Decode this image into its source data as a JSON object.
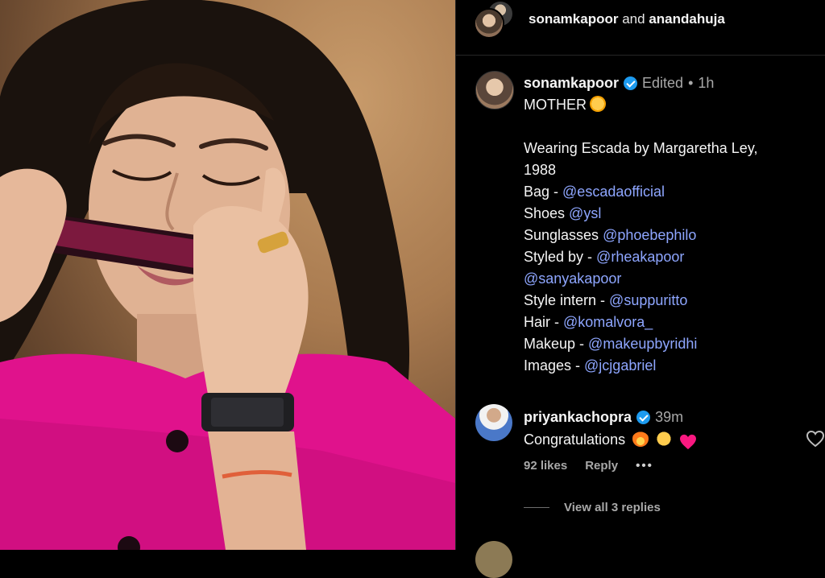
{
  "header": {
    "user1": "sonamkapoor",
    "and": "and",
    "user2": "anandahuja"
  },
  "caption": {
    "username": "sonamkapoor",
    "edited": "Edited",
    "dot": "•",
    "time": "1h",
    "lines": [
      {
        "text": "MOTHER",
        "link": ""
      },
      {
        "text": "",
        "link": ""
      },
      {
        "text": "Wearing Escada by Margaretha Ley,",
        "link": ""
      },
      {
        "text": "1988",
        "link": ""
      },
      {
        "text": "Bag - ",
        "link": "@escadaofficial"
      },
      {
        "text": "Shoes ",
        "link": "@ysl"
      },
      {
        "text": "Sunglasses ",
        "link": "@phoebephilo"
      },
      {
        "text": "Styled by - ",
        "link": "@rheakapoor"
      },
      {
        "text": "",
        "link": "@sanyakapoor"
      },
      {
        "text": "Style intern - ",
        "link": "@suppuritto"
      },
      {
        "text": "Hair - ",
        "link": "@komalvora_"
      },
      {
        "text": "Makeup - ",
        "link": "@makeupbyridhi"
      },
      {
        "text": "Images - ",
        "link": "@jcjgabriel"
      }
    ],
    "emoji": "kissing-face-emoji"
  },
  "comment": {
    "username": "priyankachopra",
    "time": "39m",
    "text": "Congratulations",
    "emojis": [
      "fire-emoji",
      "raising-hands-emoji",
      "red-heart-emoji"
    ],
    "likes": "92 likes",
    "reply": "Reply",
    "more": "•••",
    "view_replies": "View all 3 replies"
  },
  "colors": {
    "link": "#8ea6ff",
    "verified": "#1d9bf0",
    "muted": "#a8a8a8",
    "jacket": "#e0128c"
  },
  "icons": [
    "verified-badge-icon",
    "heart-outline-icon",
    "more-options-icon"
  ]
}
